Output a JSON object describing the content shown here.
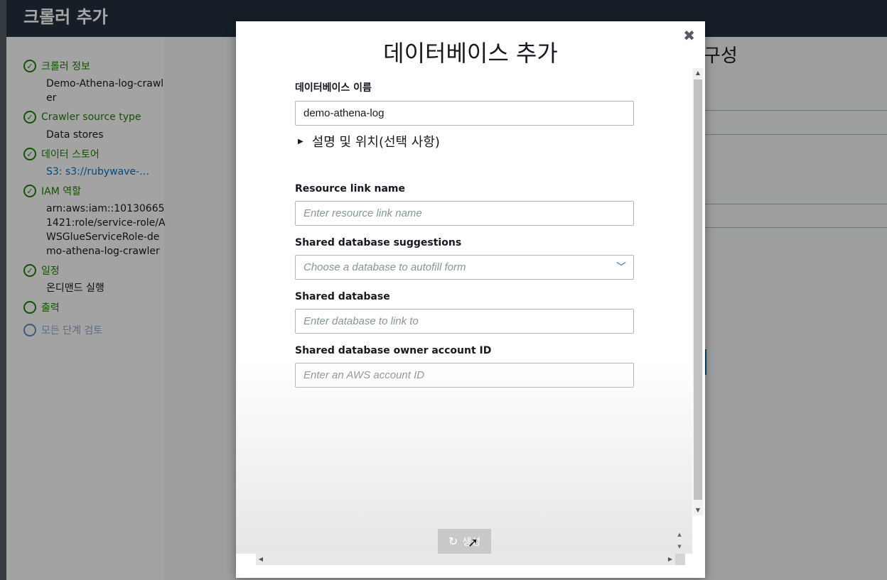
{
  "page": {
    "title": "크롤러 추가",
    "main_heading_partial": "구성"
  },
  "steps": [
    {
      "label": "크롤러 정보",
      "detail": "Demo-Athena-log-crawler",
      "state": "done"
    },
    {
      "label": "Crawler source type",
      "detail": "Data stores",
      "state": "done"
    },
    {
      "label": "데이터 스토어",
      "detail": "S3: s3://rubywave-a...",
      "state": "done",
      "detail_is_link": true
    },
    {
      "label": "IAM 역할",
      "detail": "arn:aws:iam::101306651421:role/service-role/AWSGlueServiceRole-demo-athena-log-crawler",
      "state": "done"
    },
    {
      "label": "일정",
      "detail": "온디맨드 실행",
      "state": "done"
    },
    {
      "label": "출력",
      "detail": "",
      "state": "current"
    },
    {
      "label": "모든 단계 검토",
      "detail": "",
      "state": "pending"
    }
  ],
  "modal": {
    "title": "데이터베이스 추가",
    "close_icon": "close-icon",
    "db_name": {
      "label": "데이터베이스 이름",
      "value": "demo-athena-log"
    },
    "expander": {
      "label": "설명 및 위치(선택 사항)",
      "icon": "caret-right-icon"
    },
    "resource_link": {
      "label": "Resource link name",
      "placeholder": "Enter resource link name"
    },
    "shared_suggestions": {
      "label": "Shared database suggestions",
      "placeholder": "Choose a database to autofill form",
      "icon": "chevron-down-icon"
    },
    "shared_database": {
      "label": "Shared database",
      "placeholder": "Enter database to link to"
    },
    "owner_account": {
      "label": "Shared database owner account ID",
      "placeholder": "Enter an AWS account ID"
    },
    "create_button": {
      "label": "생성",
      "icon": "spinner-icon"
    }
  },
  "colors": {
    "accent": "#0073bb",
    "success": "#1d8102",
    "header": "#232f3e"
  }
}
